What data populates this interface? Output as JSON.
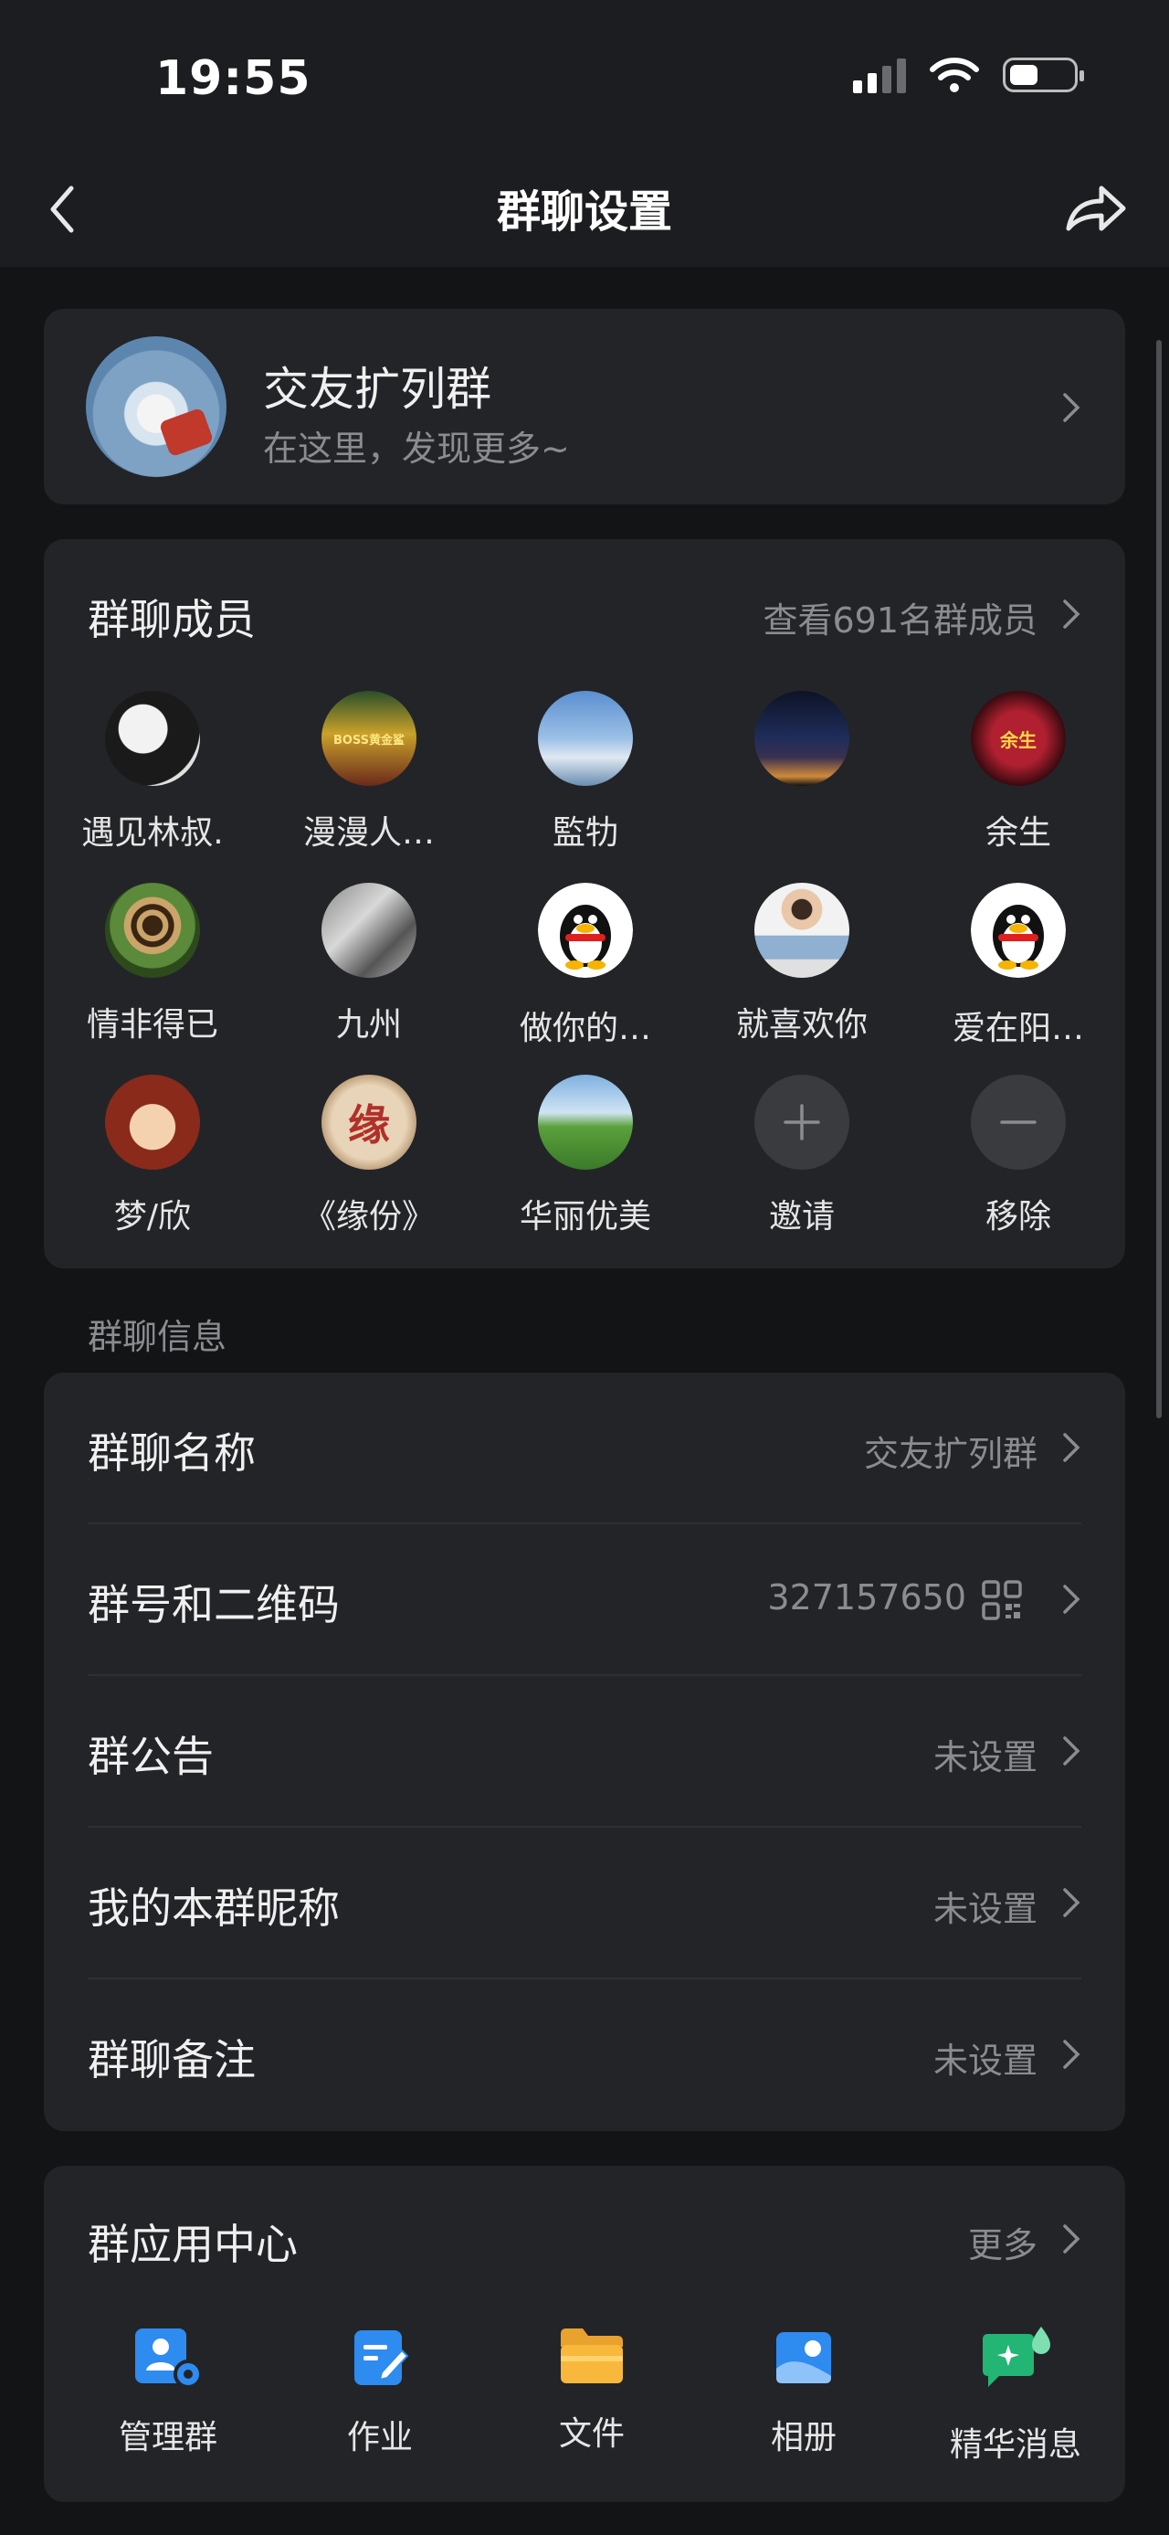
{
  "status": {
    "time": "19:55"
  },
  "nav": {
    "title": "群聊设置",
    "back_icon": "chevron-left-icon",
    "share_icon": "share-icon"
  },
  "group": {
    "name": "交友扩列群",
    "description": "在这里，发现更多~"
  },
  "members": {
    "title": "群聊成员",
    "view_all": "查看691名群成员",
    "list": [
      {
        "name": "遇见林叔."
      },
      {
        "name": "漫漫人…"
      },
      {
        "name": "監牞"
      },
      {
        "name": ""
      },
      {
        "name": "余生"
      },
      {
        "name": "情非得已"
      },
      {
        "name": "九州"
      },
      {
        "name": "做你的…"
      },
      {
        "name": "就喜欢你"
      },
      {
        "name": "爱在阳…"
      },
      {
        "name": "梦/欣"
      },
      {
        "name": "《缘份》"
      },
      {
        "name": "华丽优美"
      }
    ],
    "avatar_texts": {
      "boss": "BOSS黄金鲨",
      "yusheng": "余生",
      "yuan": "缘"
    },
    "invite_label": "邀请",
    "remove_label": "移除"
  },
  "info": {
    "section_label": "群聊信息",
    "rows": [
      {
        "label": "群聊名称",
        "value": "交友扩列群"
      },
      {
        "label": "群号和二维码",
        "value": "327157650"
      },
      {
        "label": "群公告",
        "value": "未设置"
      },
      {
        "label": "我的本群昵称",
        "value": "未设置"
      },
      {
        "label": "群聊备注",
        "value": "未设置"
      }
    ]
  },
  "apps": {
    "title": "群应用中心",
    "more": "更多",
    "items": [
      {
        "label": "管理群",
        "icon": "manage-group-icon",
        "color": "#2E8BF0"
      },
      {
        "label": "作业",
        "icon": "homework-icon",
        "color": "#2E8BF0"
      },
      {
        "label": "文件",
        "icon": "folder-icon",
        "color": "#F7B83C"
      },
      {
        "label": "相册",
        "icon": "album-icon",
        "color": "#2E8BF0"
      },
      {
        "label": "精华消息",
        "icon": "essence-message-icon",
        "color": "#22B573"
      }
    ]
  }
}
